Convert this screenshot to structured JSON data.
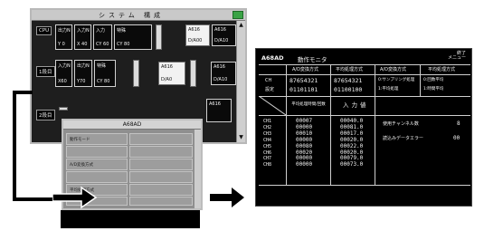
{
  "main_window": {
    "title": "システム 構成",
    "scroll_up": "▲",
    "scroll_down": "▼",
    "rows": [
      {
        "label": "CPU",
        "cards": [
          {
            "line1": "出力N",
            "line2": "Y 0"
          },
          {
            "line1": "入力N",
            "line2": "X 40"
          },
          {
            "line1": "入力",
            "line2": "CY 60"
          },
          {
            "line1": "特殊",
            "line2": "CY 80"
          },
          {
            "line1": "A616",
            "line2": "D/A00"
          },
          {
            "line1": "A616",
            "line2": "D/A10"
          }
        ]
      },
      {
        "label": "1段目",
        "cards": [
          {
            "line1": "入力N",
            "line2": "X60"
          },
          {
            "line1": "出力N",
            "line2": "Y70"
          },
          {
            "line1": "特殊",
            "line2": "CY 80"
          },
          {
            "line1": "A616",
            "line2": "D/A0"
          },
          {
            "line1": "A616",
            "line2": "D/A10"
          }
        ]
      },
      {
        "label": "2段目",
        "cards": [
          {
            "line1": "A616",
            "line2": ""
          }
        ]
      }
    ]
  },
  "grey_dialog": {
    "title": "A68AD",
    "left_rows": [
      "動作モード",
      "",
      "A/D変換方式",
      "",
      "平均処理方式",
      ""
    ]
  },
  "monitor_panel": {
    "model": "A68AD",
    "mode_title": "動作モニタ",
    "top_right": [
      "終了",
      "メニュー"
    ],
    "header_cols": [
      "A/D変換方式",
      "平均処理方式",
      "A/D変換方式",
      "平均処理方式"
    ],
    "ch_label": "CH",
    "setting_label": "設定",
    "bits_row1": [
      "87654321",
      "87654321"
    ],
    "bits_row2": [
      "01101101",
      "01100100"
    ],
    "mode_desc_1": "0:サンプリング処理",
    "mode_desc_2": "1:平均処理",
    "avg_desc_1": "0:回数平均",
    "avg_desc_2": "1:時間平均",
    "avg_col_header": "平均処理時間/回数",
    "input_header": "入力値",
    "channels": [
      "CH1",
      "CH2",
      "CH3",
      "CH4",
      "CH5",
      "CH6",
      "CH7",
      "CH8"
    ],
    "avg_values": [
      "00007",
      "00000",
      "00010",
      "00000",
      "00080",
      "00020",
      "00000",
      "00000"
    ],
    "input_values": [
      "00040.0",
      "00081.0",
      "00017.0",
      "00020.0",
      "00022.0",
      "00020.0",
      "00079.0",
      "00073.0"
    ],
    "used_channels_label": "使用チャンネル数",
    "used_channels_value": "8",
    "error_label": "読込みデータエラー",
    "error_value": "00"
  }
}
